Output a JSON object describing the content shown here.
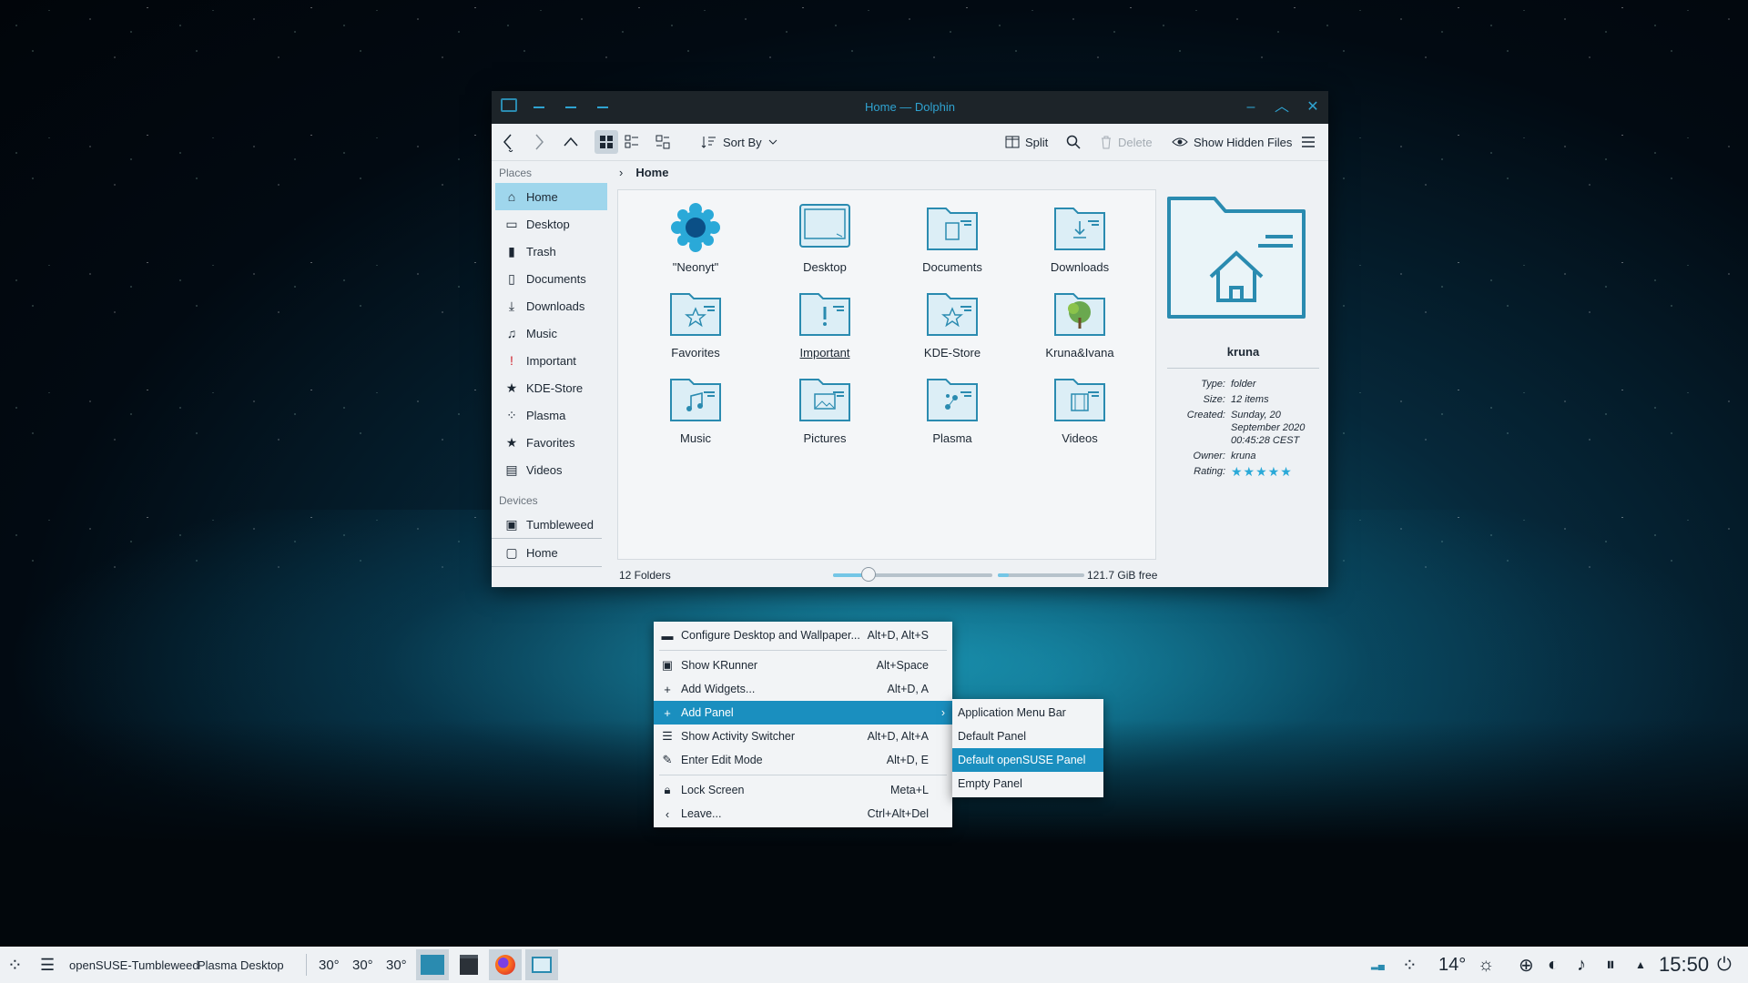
{
  "window": {
    "title": "Home — Dolphin",
    "toolbar": {
      "sort_by": "Sort By",
      "split": "Split",
      "delete": "Delete",
      "show_hidden": "Show Hidden Files"
    },
    "breadcrumb": {
      "current": "Home"
    },
    "sidebar": {
      "places_heading": "Places",
      "places": [
        "Home",
        "Desktop",
        "Trash",
        "Documents",
        "Downloads",
        "Music",
        "Important",
        "KDE-Store",
        "Plasma",
        "Favorites",
        "Videos"
      ],
      "devices_heading": "Devices",
      "devices": [
        "Tumbleweed",
        "Home"
      ]
    },
    "files": [
      "\"Neonyt\"",
      "Desktop",
      "Documents",
      "Downloads",
      "Favorites",
      "Important",
      "KDE-Store",
      "Kruna&Ivana",
      "Music",
      "Pictures",
      "Plasma",
      "Videos"
    ],
    "info": {
      "name": "kruna",
      "type_k": "Type:",
      "type_v": "folder",
      "size_k": "Size:",
      "size_v": "12 items",
      "created_k": "Created:",
      "created_v": "Sunday, 20 September 2020 00:45:28 CEST",
      "owner_k": "Owner:",
      "owner_v": "kruna",
      "rating_k": "Rating:",
      "rating_v": "★★★★★",
      "rating": 5
    },
    "status": {
      "folders": "12 Folders",
      "free": "121.7 GiB free",
      "zoom_level": 0.22,
      "space_used": 0.13
    }
  },
  "context_menu": {
    "items": [
      {
        "label": "Configure Desktop and Wallpaper...",
        "shortcut": "Alt+D, Alt+S"
      },
      {
        "label": "Show KRunner",
        "shortcut": "Alt+Space"
      },
      {
        "label": "Add Widgets...",
        "shortcut": "Alt+D, A"
      },
      {
        "label": "Add Panel",
        "shortcut": ""
      },
      {
        "label": "Show Activity Switcher",
        "shortcut": "Alt+D, Alt+A"
      },
      {
        "label": "Enter Edit Mode",
        "shortcut": "Alt+D, E"
      },
      {
        "label": "Lock Screen",
        "shortcut": "Meta+L"
      },
      {
        "label": "Leave...",
        "shortcut": "Ctrl+Alt+Del"
      }
    ],
    "submenu": [
      "Application Menu Bar",
      "Default Panel",
      "Default openSUSE Panel",
      "Empty Panel"
    ]
  },
  "taskbar": {
    "host": "openSUSE-Tumbleweed",
    "activity": "Plasma Desktop",
    "temps": [
      "30°",
      "30°",
      "30°"
    ],
    "weather": "14°",
    "clock": "15:50"
  },
  "colors": {
    "accent": "#1a8fbf",
    "titlebar": "#1d2429",
    "icon_blue": "#2a8bb0"
  }
}
